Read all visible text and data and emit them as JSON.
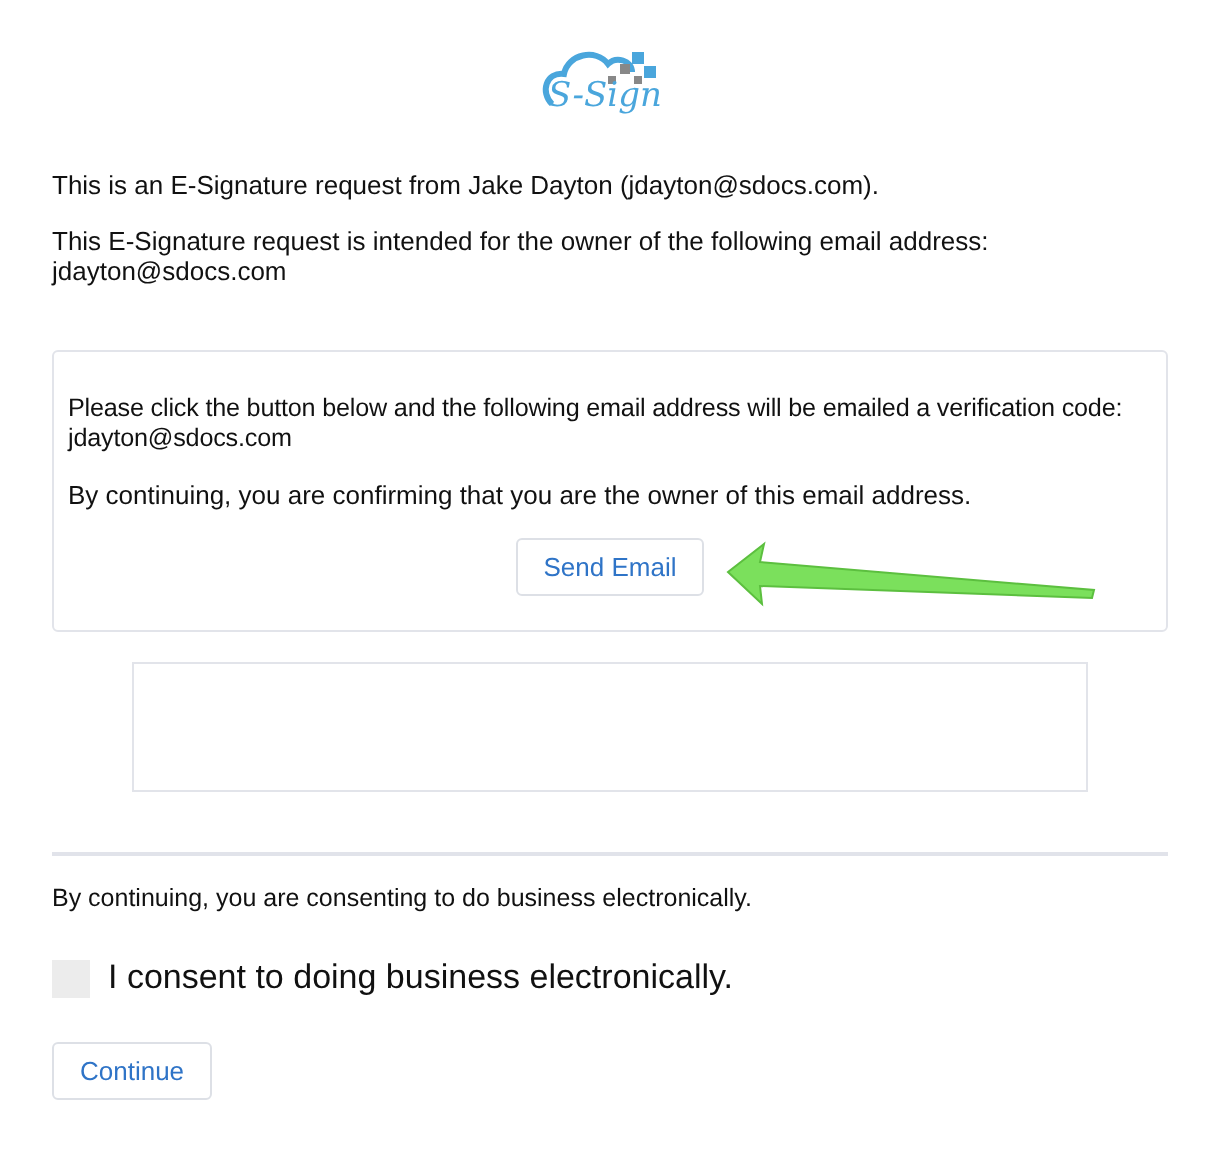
{
  "logo": {
    "text": "S-Sign"
  },
  "intro": [
    "This is an E-Signature request from Jake Dayton (jdayton@sdocs.com).",
    "This E-Signature request is intended for the owner of the following email address: jdayton@sdocs.com"
  ],
  "verification_card": {
    "paragraphs": [
      "Please click the button below and the following email address will be emailed a verification code: jdayton@sdocs.com",
      "By continuing, you are confirming that you are the owner of this email address."
    ],
    "button": "Send Email"
  },
  "consent_notice": "By continuing, you are consenting to do business electronically.",
  "consent_checkbox": {
    "label": "I consent to doing business electronically.",
    "checked": false
  },
  "continue_button": "Continue"
}
